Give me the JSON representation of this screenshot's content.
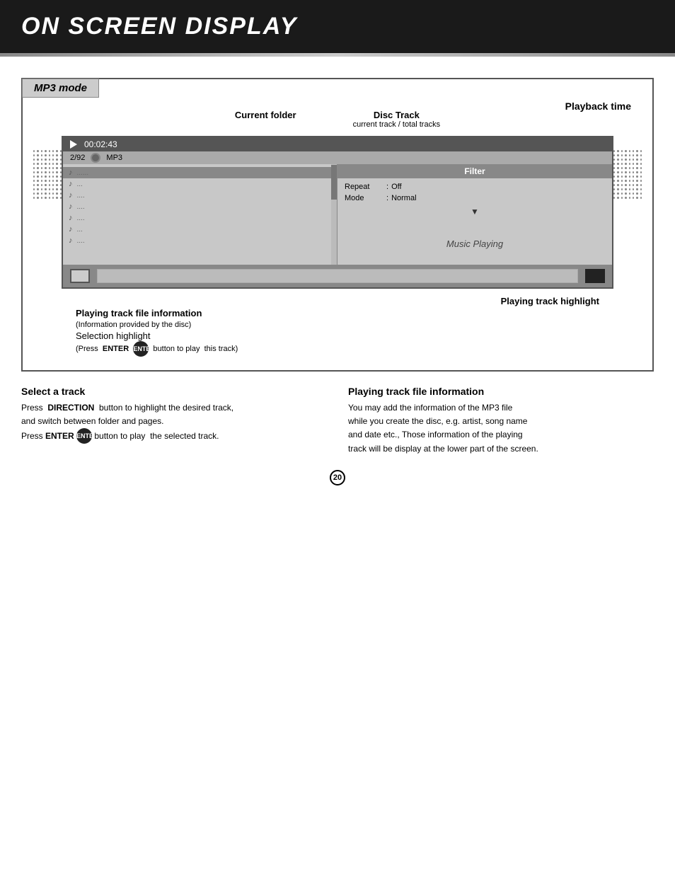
{
  "header": {
    "title": "ON SCREEN DISPLAY"
  },
  "diagram": {
    "section_label": "MP3 mode",
    "callouts": {
      "current_folder": "Current folder",
      "disc_track": "Disc Track",
      "disc_track_sub": "current track / total tracks",
      "playback_time": "Playback  time"
    },
    "screen": {
      "play_time": "00:02:43",
      "track_fraction": "2/92",
      "track_label": "MP3",
      "filter_label": "Filter",
      "repeat_label": "Repeat",
      "repeat_colon": ":",
      "repeat_value": "Off",
      "mode_label": "Mode",
      "mode_colon": ":",
      "mode_value": "Normal",
      "music_playing": "Music Playing",
      "file_items": [
        {
          "dots": "......",
          "selected": true
        },
        {
          "dots": "...",
          "selected": false
        },
        {
          "dots": "....",
          "selected": false
        },
        {
          "dots": "....",
          "selected": false
        },
        {
          "dots": "....",
          "selected": false
        },
        {
          "dots": "...",
          "selected": false
        },
        {
          "dots": "....",
          "selected": false
        }
      ]
    },
    "bottom_annotations": {
      "playing_track_highlight": "Playing track  highlight",
      "playing_track_info": "Playing track   file information",
      "playing_track_info_sub": "(Information provided by  the disc)",
      "selection_highlight": "Selection highlight",
      "selection_highlight_sub": "(Press  ENTER        button to play   this track)"
    }
  },
  "sections": {
    "select_track": {
      "heading": "Select a  track",
      "text1": "Press  DIRECTION  button to highlight the desired track,",
      "text2": "and  switch between folder and pages.",
      "text3": "Press ENTER        button to play  the selected track."
    },
    "playing_track_info": {
      "heading": "Playing track  file information",
      "text1": "You  may add the  information of the  MP3 file",
      "text2": "while you create  the disc, e.g.  artist, song name",
      "text3": "and date etc.,   Those information of   the playing",
      "text4": "track will be  display at the  lower part of  the screen."
    }
  },
  "page_number": "20"
}
